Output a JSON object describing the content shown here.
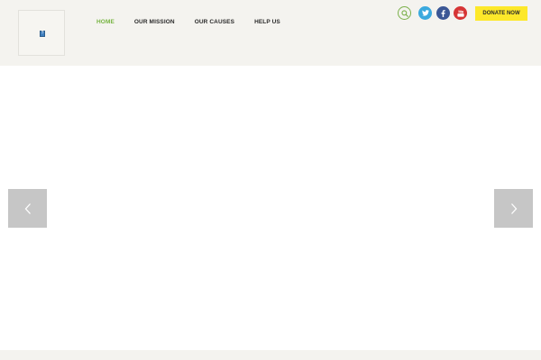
{
  "header": {
    "nav": [
      {
        "label": "HOME",
        "active": true
      },
      {
        "label": "OUR MISSION",
        "active": false
      },
      {
        "label": "OUR CAUSES",
        "active": false
      },
      {
        "label": "HELP US",
        "active": false
      }
    ],
    "logo_placeholder": "?",
    "social": {
      "search_icon": "search-icon",
      "twitter_icon": "twitter-icon",
      "facebook_icon": "facebook-icon",
      "youtube_icon": "youtube-icon"
    },
    "donate_label": "DONATE NOW"
  },
  "slider": {
    "prev_icon": "chevron-left-icon",
    "next_icon": "chevron-right-icon"
  },
  "colors": {
    "header_bg": "#f4f3ef",
    "nav_active": "#77b442",
    "twitter": "#3aa9de",
    "facebook": "#3b5795",
    "youtube": "#d63535",
    "donate": "#fde82a",
    "arrow_bg": "#c6c6c6"
  }
}
